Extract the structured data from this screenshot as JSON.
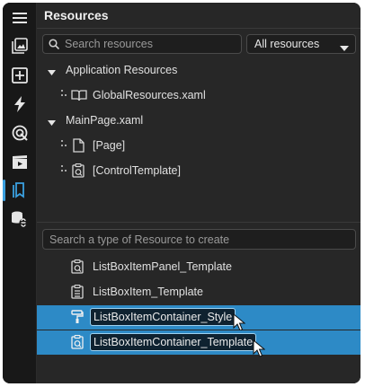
{
  "activity_bar": {
    "icons": [
      "hamburger-menu-icon",
      "gallery-icon",
      "add-box-icon",
      "lightning-icon",
      "target-icon",
      "media-icon",
      "resources-bookmark-icon",
      "database-link-icon"
    ],
    "active": "resources-bookmark-icon"
  },
  "panel": {
    "title": "Resources",
    "search": {
      "placeholder": "Search resources",
      "value": ""
    },
    "filter": {
      "selected": "All resources"
    }
  },
  "tree": {
    "groups": [
      {
        "label": "Application Resources",
        "expanded": true,
        "items": [
          {
            "label": "GlobalResources.xaml",
            "icon": "open-book-icon"
          }
        ]
      },
      {
        "label": "MainPage.xaml",
        "expanded": true,
        "items": [
          {
            "label": "[Page]",
            "icon": "page-icon"
          },
          {
            "label": "[ControlTemplate]",
            "icon": "control-template-icon"
          }
        ]
      }
    ]
  },
  "create": {
    "search": {
      "placeholder": "Search a type of Resource to create",
      "value": ""
    },
    "items": [
      {
        "label": "ListBoxItemPanel_Template",
        "icon": "template-clipboard-icon",
        "selected": false
      },
      {
        "label": "ListBoxItem_Template",
        "icon": "list-clipboard-icon",
        "selected": false
      },
      {
        "label": "ListBoxItemContainer_Style",
        "icon": "paint-roller-icon",
        "selected": true
      },
      {
        "label": "ListBoxItemContainer_Template",
        "icon": "template-clipboard-icon",
        "selected": true
      }
    ]
  },
  "colors": {
    "selection": "#2d8ac6",
    "accent": "#3aa0e0",
    "panel_bg": "#272727"
  }
}
